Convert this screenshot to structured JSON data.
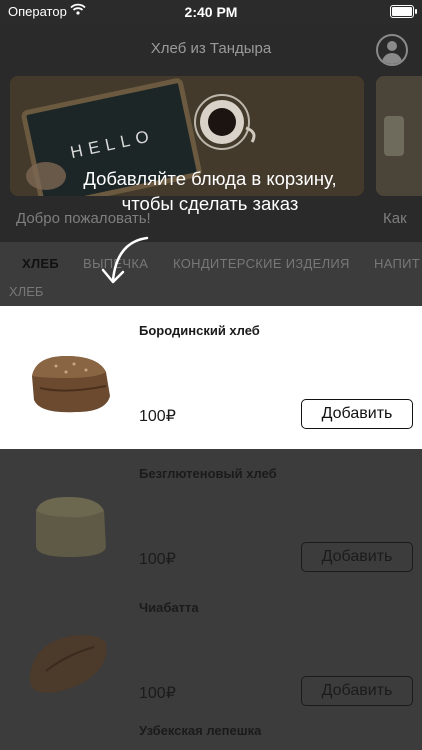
{
  "status": {
    "carrier": "Оператор",
    "time": "2:40 PM"
  },
  "header": {
    "title": "Хлеб из Тандыра"
  },
  "banners": [
    {
      "label": "Добро пожаловать!"
    },
    {
      "label": "Как"
    }
  ],
  "categories": [
    {
      "label": "ХЛЕБ",
      "active": true
    },
    {
      "label": "ВЫПЕЧКА",
      "active": false
    },
    {
      "label": "КОНДИТЕРСКИЕ ИЗДЕЛИЯ",
      "active": false
    },
    {
      "label": "НАПИТ",
      "active": false
    }
  ],
  "section_title": "ХЛЕБ",
  "products": [
    {
      "name": "Бородинский хлеб",
      "price": "100₽",
      "button": "Добавить"
    },
    {
      "name": "Безглютеновый хлеб",
      "price": "100₽",
      "button": "Добавить"
    },
    {
      "name": "Чиабатта",
      "price": "100₽",
      "button": "Добавить"
    },
    {
      "name": "Узбекская лепешка",
      "price": "",
      "button": ""
    }
  ],
  "hint": {
    "text": "Добавляйте блюда в корзину, чтобы сделать заказ"
  },
  "icons": {
    "profile": "user-circle-icon",
    "wifi": "wifi-icon",
    "battery": "battery-icon",
    "arrow": "curved-arrow-down-icon"
  }
}
